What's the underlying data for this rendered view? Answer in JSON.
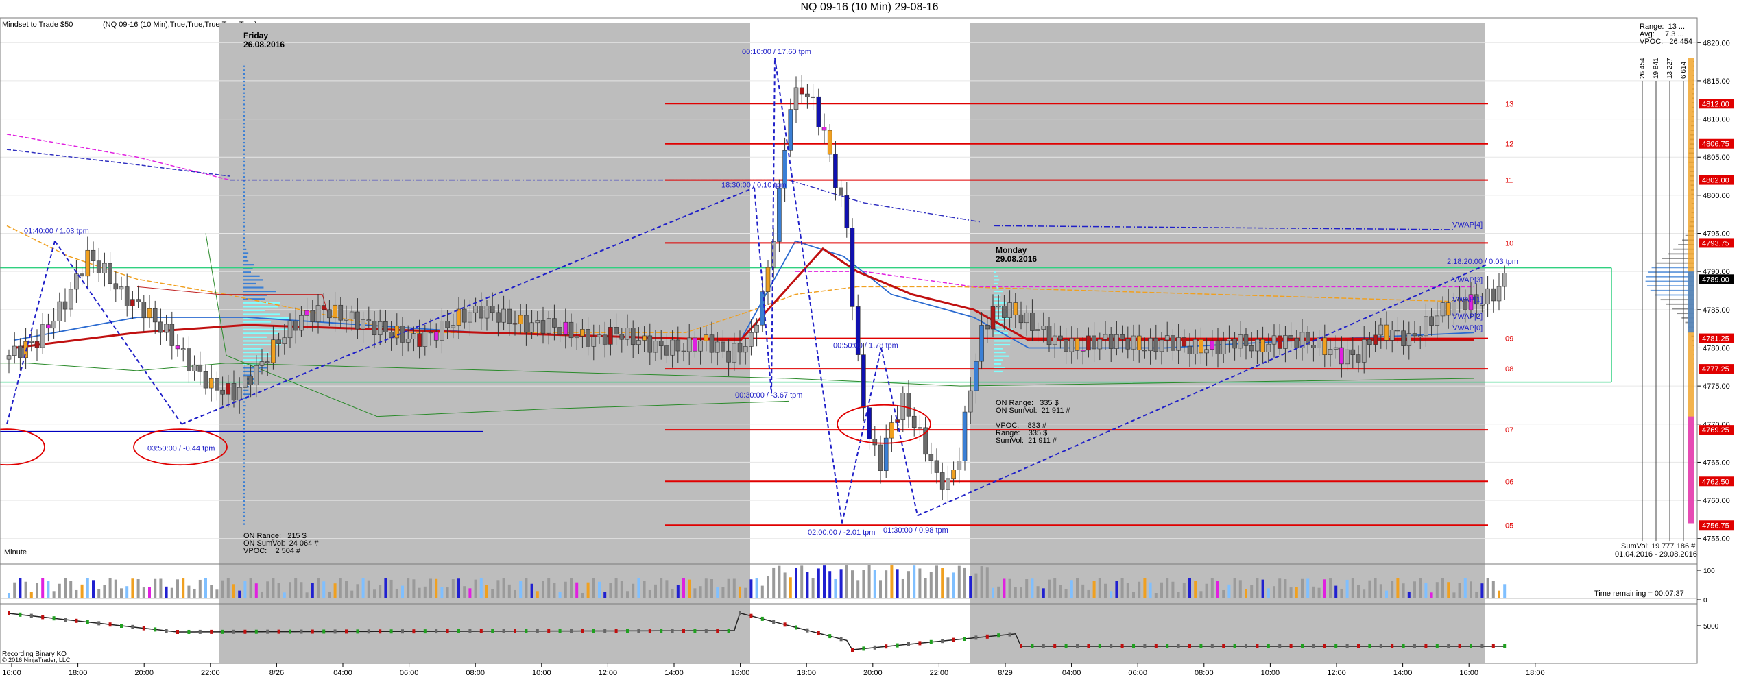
{
  "window": {
    "title": "NQ 09-16 (10 Min)  29-08-16"
  },
  "header": {
    "indicator": "Mindset to Trade  $50",
    "params": "(NQ 09-16 (10 Min),True,True,True,True,True)"
  },
  "colors": {
    "bull": "#a9a9a9",
    "bear": "#6b6b6b",
    "session_shade": "#bdbdbd",
    "profile_blue": "#3a7fd5",
    "profile_cyan": "#7fffff",
    "level_red": "#e00000",
    "vwap_blue": "#2020c8",
    "zone_green": "#30d080",
    "orange": "#f0a020",
    "magenta": "#e020e0",
    "dark_red": "#b01818"
  },
  "sessions": [
    {
      "day": "Friday",
      "date": "26.08.2016",
      "stats": [
        "ON Range:   215 $",
        "ON SumVol:  24 064 #",
        "VPOC:    2 504 #"
      ]
    },
    {
      "day": "Monday",
      "date": "29.08.2016",
      "stats": [
        "ON Range:   335 $",
        "ON SumVol:  21 911 #",
        "",
        "VPOC:    833 #",
        "Range:    335 $",
        "SumVol:  21 911 #"
      ]
    }
  ],
  "annotations": [
    {
      "text": "01:40:00 / 1.03 tpm"
    },
    {
      "text": "03:50:00 / -0.44 tpm"
    },
    {
      "text": "00:10:00 / 17.60 tpm"
    },
    {
      "text": "18:30:00 / 0.10 tpm"
    },
    {
      "text": "00:30:00 / -3.67 tpm"
    },
    {
      "text": "00:50:00 / 1.78 tpm"
    },
    {
      "text": "02:00:00 / -2.01 tpm"
    },
    {
      "text": "01:30:00 / 0.98 tpm"
    },
    {
      "text": "2:18:20:00 / 0.03 tpm"
    }
  ],
  "level_labels": [
    "13",
    "12",
    "11",
    "10",
    "09",
    "08",
    "07",
    "06",
    "05"
  ],
  "vwap_labels": [
    "VWAP[4]",
    "VWAP[3]",
    "VWAP[1]",
    "VWAP[2]",
    "VWAP[0]"
  ],
  "right_panel": {
    "stats": [
      "Range:  13 ...",
      "Avg:     7.3 ...",
      "VPOC:   26 454"
    ],
    "vertical_numbers": [
      "26 454",
      "19 841",
      "13 227",
      "6 614"
    ],
    "sumvol": "SumVol: 19 777 186 #",
    "date_range": "01.04.2016 - 29.08.2016"
  },
  "price_badges": [
    "4812.00",
    "4806.75",
    "4802.00",
    "4793.75",
    "4789.00",
    "4781.25",
    "4777.25",
    "4769.25",
    "4762.50",
    "4756.75"
  ],
  "footer": {
    "period": "Minute",
    "time_remaining": "Time remaining = 00:07:37",
    "recorder": "Recording Binary KO",
    "copyright": "© 2016 NinjaTrader, LLC"
  },
  "volume_panel": {
    "ticks": [
      "100",
      "0"
    ]
  },
  "lower_panel": {
    "ticks": [
      "5000"
    ]
  },
  "chart_data": {
    "type": "candlestick",
    "title": "NQ 09-16 (10 Min)  29-08-16",
    "x_ticks": [
      "16:00",
      "18:00",
      "20:00",
      "22:00",
      "8/26",
      "04:00",
      "06:00",
      "08:00",
      "10:00",
      "12:00",
      "14:00",
      "16:00",
      "18:00",
      "20:00",
      "22:00",
      "8/29",
      "04:00",
      "06:00",
      "08:00",
      "10:00",
      "12:00",
      "14:00",
      "16:00",
      "18:00"
    ],
    "y_ticks": [
      4755,
      4760,
      4765,
      4770,
      4775,
      4780,
      4785,
      4790,
      4795,
      4800,
      4805,
      4810,
      4815,
      4820
    ],
    "ylim": [
      4753,
      4822
    ],
    "levels": [
      {
        "label": "13",
        "price": 4812.0
      },
      {
        "label": "12",
        "price": 4806.75
      },
      {
        "label": "11",
        "price": 4802.0
      },
      {
        "label": "10",
        "price": 4793.75
      },
      {
        "label": "09",
        "price": 4781.25
      },
      {
        "label": "08",
        "price": 4777.25
      },
      {
        "label": "07",
        "price": 4769.25
      },
      {
        "label": "06",
        "price": 4762.5
      },
      {
        "label": "05",
        "price": 4756.75
      }
    ],
    "last_price": 4789.0,
    "close_path": [
      [
        0,
        4779
      ],
      [
        5,
        4781
      ],
      [
        10,
        4786
      ],
      [
        14,
        4792
      ],
      [
        17,
        4790
      ],
      [
        20,
        4787
      ],
      [
        24,
        4785
      ],
      [
        28,
        4782
      ],
      [
        32,
        4778
      ],
      [
        36,
        4775
      ],
      [
        40,
        4774
      ],
      [
        44,
        4777
      ],
      [
        48,
        4781
      ],
      [
        52,
        4784
      ],
      [
        56,
        4785
      ],
      [
        60,
        4784
      ],
      [
        64,
        4783
      ],
      [
        68,
        4782
      ],
      [
        72,
        4781
      ],
      [
        76,
        4782
      ],
      [
        80,
        4784
      ],
      [
        84,
        4785
      ],
      [
        88,
        4784
      ],
      [
        92,
        4783
      ],
      [
        96,
        4783
      ],
      [
        100,
        4782
      ],
      [
        104,
        4781
      ],
      [
        108,
        4782
      ],
      [
        112,
        4781
      ],
      [
        116,
        4780
      ],
      [
        120,
        4780
      ],
      [
        124,
        4781
      ],
      [
        128,
        4779
      ],
      [
        132,
        4781
      ],
      [
        135,
        4790
      ],
      [
        137,
        4800
      ],
      [
        139,
        4812
      ],
      [
        141,
        4814
      ],
      [
        143,
        4812
      ],
      [
        145,
        4808
      ],
      [
        147,
        4802
      ],
      [
        149,
        4796
      ],
      [
        150,
        4786
      ],
      [
        151,
        4778
      ],
      [
        153,
        4768
      ],
      [
        155,
        4765
      ],
      [
        157,
        4770
      ],
      [
        159,
        4773
      ],
      [
        161,
        4770
      ],
      [
        163,
        4767
      ],
      [
        165,
        4763
      ],
      [
        167,
        4762
      ],
      [
        169,
        4766
      ],
      [
        171,
        4775
      ],
      [
        173,
        4782
      ],
      [
        175,
        4785
      ],
      [
        178,
        4785
      ],
      [
        182,
        4783
      ],
      [
        186,
        4781
      ],
      [
        190,
        4780
      ],
      [
        194,
        4781
      ],
      [
        198,
        4781
      ],
      [
        202,
        4780
      ],
      [
        206,
        4781
      ],
      [
        210,
        4780
      ],
      [
        214,
        4780
      ],
      [
        218,
        4781
      ],
      [
        222,
        4780
      ],
      [
        226,
        4781
      ],
      [
        230,
        4781
      ],
      [
        234,
        4780
      ],
      [
        237,
        4779
      ],
      [
        240,
        4779
      ],
      [
        243,
        4782
      ],
      [
        246,
        4782
      ],
      [
        249,
        4781
      ],
      [
        252,
        4783
      ],
      [
        255,
        4785
      ],
      [
        258,
        4786
      ],
      [
        261,
        4786
      ],
      [
        264,
        4787
      ],
      [
        266,
        4789
      ]
    ]
  }
}
